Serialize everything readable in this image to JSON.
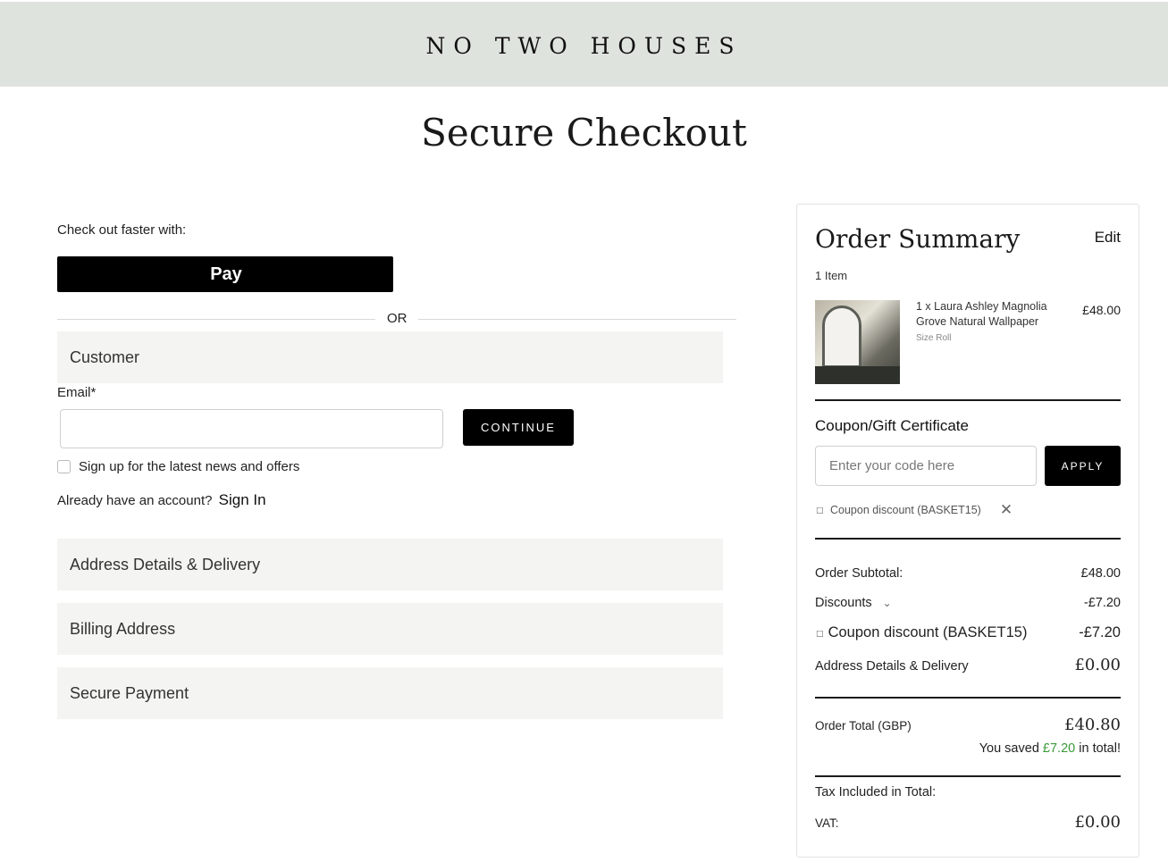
{
  "header": {
    "brand": "NO TWO HOUSES"
  },
  "page": {
    "title": "Secure Checkout"
  },
  "express": {
    "label": "Check out faster with:",
    "apple_pay_label": "Pay",
    "apple_logo": "",
    "or_text": "OR"
  },
  "customer": {
    "section_label": "Customer",
    "email_label": "Email*",
    "email_value": "",
    "continue_label": "CONTINUE",
    "newsletter_label": "Sign up for the latest news and offers",
    "newsletter_checked": false,
    "account_text": "Already have an account?",
    "sign_in_label": "Sign In"
  },
  "sections": {
    "address": "Address Details & Delivery",
    "billing": "Billing Address",
    "payment": "Secure Payment"
  },
  "summary": {
    "title": "Order Summary",
    "edit_label": "Edit",
    "item_count": "1 Item",
    "product": {
      "name": "1 x Laura Ashley Magnolia Grove Natural Wallpaper",
      "variant": "Size Roll",
      "price": "£48.00"
    },
    "coupon": {
      "title": "Coupon/Gift Certificate",
      "placeholder": "Enter your code here",
      "apply_label": "APPLY",
      "applied_label": "Coupon discount (BASKET15)"
    },
    "totals": {
      "subtotal_label": "Order Subtotal:",
      "subtotal_value": "£48.00",
      "discounts_label": "Discounts",
      "discounts_value": "-£7.20",
      "coupon_label": "Coupon discount (BASKET15)",
      "coupon_value": "-£7.20",
      "delivery_label": "Address Details & Delivery",
      "delivery_value": "£0.00",
      "order_total_label": "Order Total (GBP)",
      "order_total_value": "£40.80",
      "saved_prefix": "You saved",
      "saved_amount": "£7.20",
      "saved_suffix": "in total!",
      "tax_label": "Tax Included in Total:",
      "vat_label": "VAT:",
      "vat_value": "£0.00"
    }
  },
  "colors": {
    "header_bg": "#dfe3dd",
    "button_bg": "#000000",
    "saved_green": "#3c9a3c",
    "section_bg": "#f4f4f2"
  },
  "icons": [
    "apple-icon",
    "tag-icon",
    "close-icon",
    "chevron-down-icon",
    "checkbox"
  ]
}
